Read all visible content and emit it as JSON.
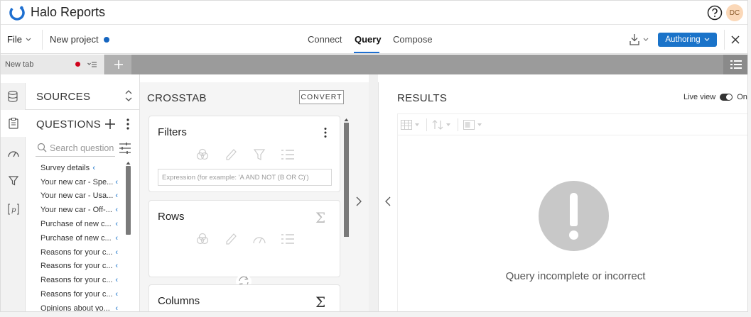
{
  "app": {
    "title": "Halo Reports",
    "avatar_initials": "DC",
    "brand_color": "#1e6fd0"
  },
  "toolbar": {
    "file_label": "File",
    "project_name": "New project",
    "nav_tabs": [
      {
        "label": "Connect"
      },
      {
        "label": "Query",
        "active": true
      },
      {
        "label": "Compose"
      }
    ],
    "authoring_label": "Authoring"
  },
  "tabs": {
    "current_tab": "New tab"
  },
  "sources": {
    "title": "SOURCES"
  },
  "questions": {
    "title": "QUESTIONS",
    "search_placeholder": "Search questions",
    "items": [
      {
        "label": "Survey details"
      },
      {
        "label": "Your new car - Spe..."
      },
      {
        "label": "Your new car - Usa..."
      },
      {
        "label": "Your new car - Off-..."
      },
      {
        "label": "Purchase of new c..."
      },
      {
        "label": "Purchase of new c..."
      },
      {
        "label": "Reasons for your c..."
      },
      {
        "label": "Reasons for your c..."
      },
      {
        "label": "Reasons for your c..."
      },
      {
        "label": "Reasons for your c..."
      },
      {
        "label": "Opinions about yo..."
      }
    ]
  },
  "crosstab": {
    "title": "CROSSTAB",
    "convert_label": "CONVERT",
    "filters_title": "Filters",
    "expression_placeholder": "Expression (for example: 'A AND NOT (B OR C)')",
    "rows_title": "Rows",
    "columns_title": "Columns",
    "sigma": "Σ"
  },
  "results": {
    "title": "RESULTS",
    "live_view_label": "Live view",
    "live_view_state": "On",
    "message": "Query incomplete or incorrect"
  }
}
